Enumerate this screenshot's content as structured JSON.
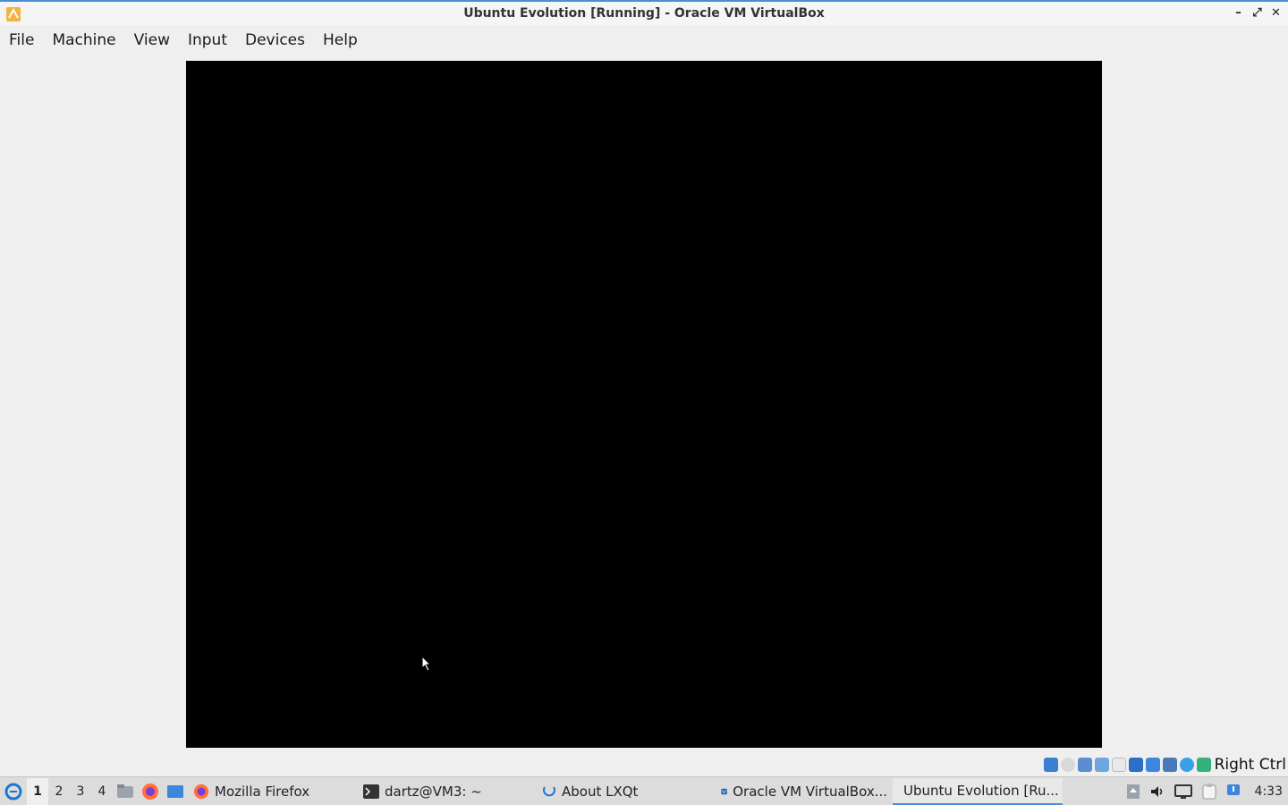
{
  "window": {
    "title": "Ubuntu Evolution [Running] - Oracle VM VirtualBox",
    "controls": [
      "minimize",
      "maximize",
      "close"
    ]
  },
  "menu": {
    "items": [
      "File",
      "Machine",
      "View",
      "Input",
      "Devices",
      "Help"
    ]
  },
  "statusbar": {
    "host_key": "Right Ctrl",
    "icons": [
      "hard-disk-icon",
      "optical-disk-icon",
      "audio-icon",
      "network-icon",
      "usb-icon",
      "shared-folder-icon",
      "display-icon",
      "video-capture-icon",
      "mouse-integration-icon",
      "keyboard-capture-icon"
    ]
  },
  "taskbar": {
    "workspaces": [
      "1",
      "2",
      "3",
      "4"
    ],
    "active_workspace": "1",
    "tasks": [
      {
        "label": "Mozilla Firefox"
      },
      {
        "label": "dartz@VM3: ~"
      },
      {
        "label": "About LXQt"
      },
      {
        "label": "Oracle VM VirtualBox..."
      },
      {
        "label": "Ubuntu Evolution [Ru..."
      }
    ],
    "clock": "4:33"
  },
  "colors": {
    "accent": "#4a8fd6",
    "vm_screen": "#000000",
    "chrome_bg": "#efefef"
  }
}
